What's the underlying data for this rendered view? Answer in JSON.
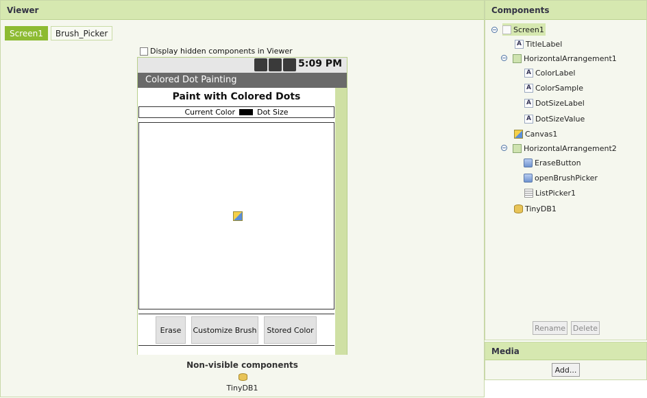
{
  "viewer": {
    "title": "Viewer",
    "screen_tabs": [
      {
        "label": "Screen1",
        "active": true
      },
      {
        "label": "Brush_Picker",
        "active": false
      }
    ],
    "hidden_toggle_label": "Display hidden components in Viewer",
    "phone": {
      "time": "5:09 PM",
      "app_title": "Colored Dot Painting",
      "title_label": "Paint with Colored Dots",
      "color_label": "Current Color",
      "dot_size_label": "Dot Size",
      "buttons": [
        "Erase",
        "Customize Brush",
        "Stored Color"
      ]
    },
    "non_visible_title": "Non-visible components",
    "non_visible_items": [
      "TinyDB1"
    ]
  },
  "components": {
    "title": "Components",
    "tree": [
      {
        "label": "Screen1",
        "icon": "screen-icon"
      },
      {
        "label": "TitleLabel",
        "icon": "label-icon"
      },
      {
        "label": "HorizontalArrangement1",
        "icon": "horizontal-arrangement-icon"
      },
      {
        "label": "ColorLabel",
        "icon": "label-icon"
      },
      {
        "label": "ColorSample",
        "icon": "label-icon"
      },
      {
        "label": "DotSizeLabel",
        "icon": "label-icon"
      },
      {
        "label": "DotSizeValue",
        "icon": "label-icon"
      },
      {
        "label": "Canvas1",
        "icon": "canvas-icon"
      },
      {
        "label": "HorizontalArrangement2",
        "icon": "horizontal-arrangement-icon"
      },
      {
        "label": "EraseButton",
        "icon": "button-icon"
      },
      {
        "label": "openBrushPicker",
        "icon": "button-icon"
      },
      {
        "label": "ListPicker1",
        "icon": "listpicker-icon"
      },
      {
        "label": "TinyDB1",
        "icon": "tinydb-icon"
      }
    ],
    "rename_label": "Rename",
    "delete_label": "Delete"
  },
  "media": {
    "title": "Media",
    "add_label": "Add..."
  },
  "colors": {
    "accent": "#8dbb32",
    "header": "#d6e8b0",
    "titlebar": "#6a6a6a"
  }
}
